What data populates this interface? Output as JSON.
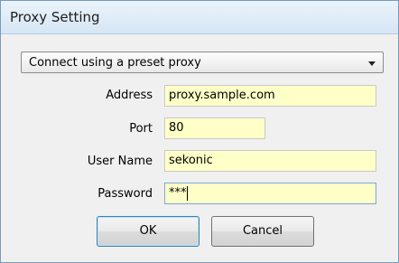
{
  "window": {
    "title": "Proxy Setting"
  },
  "proxy_mode": {
    "selected": "Connect using a preset proxy"
  },
  "fields": {
    "address": {
      "label": "Address",
      "value": "proxy.sample.com"
    },
    "port": {
      "label": "Port",
      "value": "80"
    },
    "user_name": {
      "label": "User Name",
      "value": "sekonic"
    },
    "password": {
      "label": "Password",
      "value": "***"
    }
  },
  "buttons": {
    "ok": "OK",
    "cancel": "Cancel"
  },
  "colors": {
    "field_background": "#ffffc8",
    "focus_border": "#7aa7dc",
    "title_bar": "#dbe8f5"
  },
  "icons": {
    "dropdown": "chevron-down-icon"
  }
}
